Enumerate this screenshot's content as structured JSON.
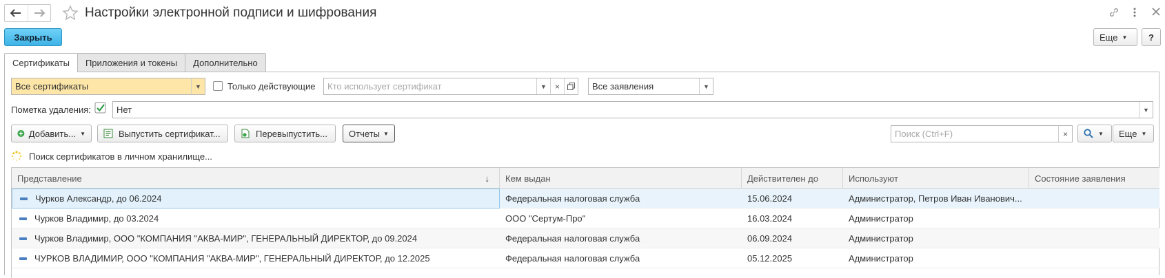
{
  "window": {
    "title": "Настройки электронной подписи и шифрования"
  },
  "toolbar": {
    "close_label": "Закрыть",
    "more_label": "Еще",
    "help_label": "?"
  },
  "tabs": [
    {
      "label": "Сертификаты",
      "active": true
    },
    {
      "label": "Приложения и токены",
      "active": false
    },
    {
      "label": "Дополнительно",
      "active": false
    }
  ],
  "filters": {
    "cert_filter_value": "Все сертификаты",
    "only_active_label": "Только действующие",
    "only_active_checked": false,
    "user_placeholder": "Кто использует сертификат",
    "requests_value": "Все заявления",
    "deletion_mark_label": "Пометка удаления:",
    "deletion_mark_checked": true,
    "deletion_mark_value": "Нет"
  },
  "actions": {
    "add_label": "Добавить...",
    "issue_label": "Выпустить сертификат...",
    "reissue_label": "Перевыпустить...",
    "reports_label": "Отчеты",
    "search_placeholder": "Поиск (Ctrl+F)",
    "more_label": "Еще"
  },
  "status": {
    "text": "Поиск сертификатов в личном хранилище..."
  },
  "table": {
    "columns": [
      "Представление",
      "Кем выдан",
      "Действителен до",
      "Используют",
      "Состояние заявления"
    ],
    "rows": [
      {
        "name": "Чурков Александр, до 06.2024",
        "issuer": "Федеральная налоговая служба",
        "valid_to": "15.06.2024",
        "users": "Администратор, Петров Иван Иванович...",
        "state": ""
      },
      {
        "name": "Чурков Владимир, до 03.2024",
        "issuer": "ООО \"Сертум-Про\"",
        "valid_to": "16.03.2024",
        "users": "Администратор",
        "state": ""
      },
      {
        "name": "Чурков Владимир, ООО \"КОМПАНИЯ \"АКВА-МИР\", ГЕНЕРАЛЬНЫЙ ДИРЕКТОР, до 09.2024",
        "issuer": "Федеральная налоговая служба",
        "valid_to": "06.09.2024",
        "users": "Администратор",
        "state": ""
      },
      {
        "name": "ЧУРКОВ ВЛАДИМИР, ООО \"КОМПАНИЯ \"АКВА-МИР\", ГЕНЕРАЛЬНЫЙ ДИРЕКТОР, до 12.2025",
        "issuer": "Федеральная налоговая служба",
        "valid_to": "05.12.2025",
        "users": "Администратор",
        "state": ""
      }
    ]
  },
  "colors": {
    "primary_button": "#3fb3e6",
    "selection": "#e8f3fb",
    "highlight_field": "#fde6a8",
    "check_green": "#2e9a47"
  }
}
